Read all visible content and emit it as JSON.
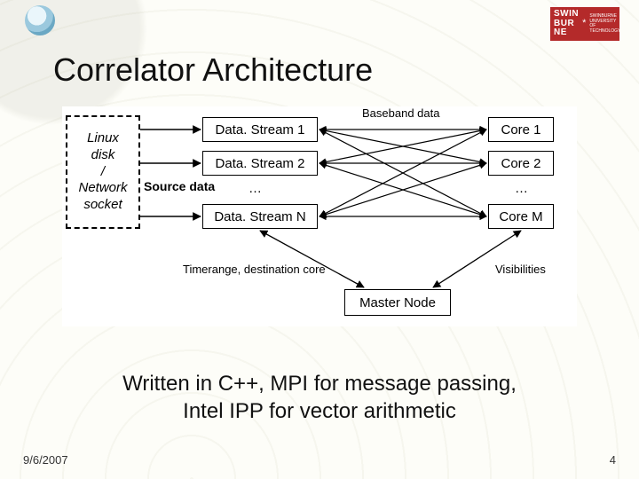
{
  "header": {
    "left_logo_alt": "globe-logo",
    "right_logo_line1": "SWIN",
    "right_logo_line2": "BUR",
    "right_logo_line3": "NE",
    "right_logo_star": "*",
    "right_logo_sub1": "SWINBURNE",
    "right_logo_sub2": "UNIVERSITY OF",
    "right_logo_sub3": "TECHNOLOGY"
  },
  "title": "Correlator Architecture",
  "diagram": {
    "source_box_l1": "Linux",
    "source_box_l2": "disk",
    "source_box_l3": "/",
    "source_box_l4": "Network",
    "source_box_l5": "socket",
    "source_label": "Source data",
    "stream1": "Data. Stream 1",
    "stream2": "Data. Stream 2",
    "streamN": "Data. Stream N",
    "stream_dots": "…",
    "core1": "Core 1",
    "core2": "Core 2",
    "coreM": "Core M",
    "core_dots": "…",
    "baseband_label": "Baseband data",
    "master": "Master Node",
    "timerange_label": "Timerange, destination core",
    "visibilities_label": "Visibilities"
  },
  "caption_line1": "Written in C++, MPI for message passing,",
  "caption_line2": "Intel IPP for vector arithmetic",
  "footer": {
    "date": "9/6/2007",
    "page": "4"
  }
}
